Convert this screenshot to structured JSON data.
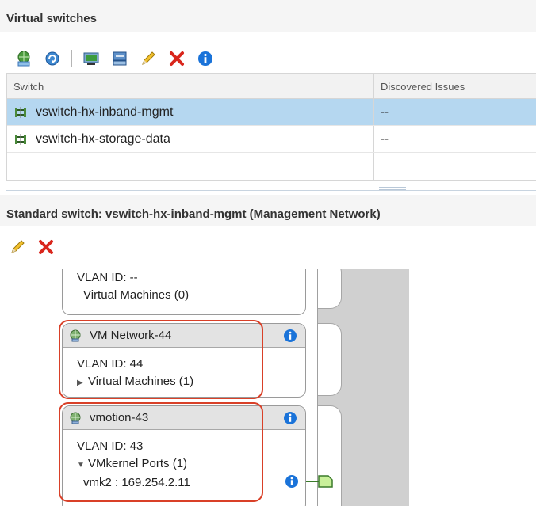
{
  "virtual_switches": {
    "title": "Virtual switches",
    "toolbar_icons": [
      "add-network-icon",
      "refresh-icon",
      "manage-physical-adapters-icon",
      "migrate-vmkernel-icon",
      "edit-icon",
      "delete-icon",
      "info-icon"
    ],
    "table": {
      "columns": [
        "Switch",
        "Discovered Issues"
      ],
      "rows": [
        {
          "name": "vswitch-hx-inband-mgmt",
          "issues": "--",
          "selected": true
        },
        {
          "name": "vswitch-hx-storage-data",
          "issues": "--",
          "selected": false
        }
      ]
    }
  },
  "standard_switch": {
    "title": "Standard switch: vswitch-hx-inband-mgmt (Management Network)",
    "toolbar_icons": [
      "edit-icon",
      "delete-icon"
    ]
  },
  "topology": {
    "top_partial": {
      "vlan": "VLAN ID: --",
      "vms": "Virtual Machines (0)"
    },
    "port_groups": [
      {
        "name": "VM Network-44",
        "vlan": "VLAN ID: 44",
        "child": "Virtual Machines (1)",
        "expanded": false
      },
      {
        "name": "vmotion-43",
        "vlan": "VLAN ID: 43",
        "child": "VMkernel Ports (1)",
        "expanded": true,
        "ports": [
          "vmk2 : 169.254.2.11"
        ]
      }
    ]
  },
  "colors": {
    "selected_row": "#b5d7f0",
    "highlight": "#d94028",
    "info_blue": "#1a73d9",
    "delete_red": "#d9261c",
    "port_green": "#c9f09a"
  }
}
